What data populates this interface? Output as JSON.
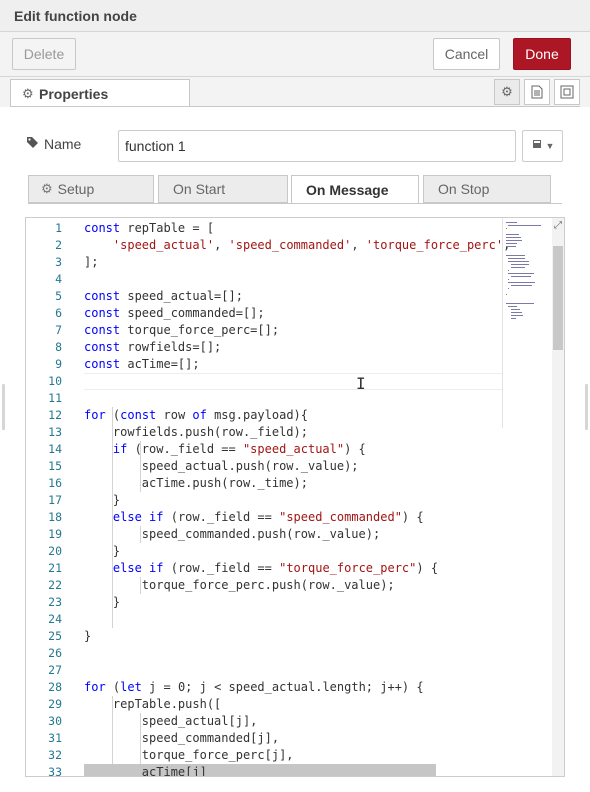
{
  "title": "Edit function node",
  "buttons": {
    "delete": "Delete",
    "cancel": "Cancel",
    "done": "Done"
  },
  "tabs": {
    "properties": "Properties"
  },
  "name_field": {
    "label": "Name",
    "value": "function 1"
  },
  "subtabs": {
    "setup": "Setup",
    "on_start": "On Start",
    "on_message": "On Message",
    "on_stop": "On Stop",
    "active": "On Message"
  },
  "editor": {
    "line_numbers": [
      "1",
      "2",
      "3",
      "4",
      "5",
      "6",
      "7",
      "8",
      "9",
      "10",
      "11",
      "12",
      "13",
      "14",
      "15",
      "16",
      "17",
      "18",
      "19",
      "20",
      "21",
      "22",
      "23",
      "24",
      "25",
      "26",
      "27",
      "28",
      "29",
      "30",
      "31",
      "32",
      "33"
    ],
    "current_line": "10",
    "lines": [
      [
        {
          "t": "const",
          "c": "kw"
        },
        {
          "t": " repTable = ["
        }
      ],
      [
        {
          "t": "    "
        },
        {
          "t": "'speed_actual'",
          "c": "str"
        },
        {
          "t": ", "
        },
        {
          "t": "'speed_commanded'",
          "c": "str"
        },
        {
          "t": ", "
        },
        {
          "t": "'torque_force_perc'",
          "c": "str"
        },
        {
          "t": ","
        }
      ],
      [
        {
          "t": "];"
        }
      ],
      [],
      [
        {
          "t": "const",
          "c": "kw"
        },
        {
          "t": " speed_actual=[];"
        }
      ],
      [
        {
          "t": "const",
          "c": "kw"
        },
        {
          "t": " speed_commanded=[];"
        }
      ],
      [
        {
          "t": "const",
          "c": "kw"
        },
        {
          "t": " torque_force_perc=[];"
        }
      ],
      [
        {
          "t": "const",
          "c": "kw"
        },
        {
          "t": " rowfields=[];"
        }
      ],
      [
        {
          "t": "const",
          "c": "kw"
        },
        {
          "t": " acTime=[];"
        }
      ],
      [],
      [],
      [
        {
          "t": "for",
          "c": "kw"
        },
        {
          "t": " ("
        },
        {
          "t": "const",
          "c": "kw"
        },
        {
          "t": " row "
        },
        {
          "t": "of",
          "c": "kw"
        },
        {
          "t": " msg.payload){"
        }
      ],
      [
        {
          "t": "    rowfields.push(row._field);"
        }
      ],
      [
        {
          "t": "    "
        },
        {
          "t": "if",
          "c": "kw"
        },
        {
          "t": " (row._field == "
        },
        {
          "t": "\"speed_actual\"",
          "c": "str"
        },
        {
          "t": ") {"
        }
      ],
      [
        {
          "t": "        speed_actual.push(row._value);"
        }
      ],
      [
        {
          "t": "        acTime.push(row._time);"
        }
      ],
      [
        {
          "t": "    }"
        }
      ],
      [
        {
          "t": "    "
        },
        {
          "t": "else",
          "c": "kw"
        },
        {
          "t": " "
        },
        {
          "t": "if",
          "c": "kw"
        },
        {
          "t": " (row._field == "
        },
        {
          "t": "\"speed_commanded\"",
          "c": "str"
        },
        {
          "t": ") {"
        }
      ],
      [
        {
          "t": "        speed_commanded.push(row._value);"
        }
      ],
      [
        {
          "t": "    }"
        }
      ],
      [
        {
          "t": "    "
        },
        {
          "t": "else",
          "c": "kw"
        },
        {
          "t": " "
        },
        {
          "t": "if",
          "c": "kw"
        },
        {
          "t": " (row._field == "
        },
        {
          "t": "\"torque_force_perc\"",
          "c": "str"
        },
        {
          "t": ") {"
        }
      ],
      [
        {
          "t": "        torque_force_perc.push(row._value);"
        }
      ],
      [
        {
          "t": "    }"
        }
      ],
      [],
      [
        {
          "t": "}"
        }
      ],
      [],
      [],
      [
        {
          "t": "for",
          "c": "kw"
        },
        {
          "t": " ("
        },
        {
          "t": "let",
          "c": "kw"
        },
        {
          "t": " j = 0; j < speed_actual.length; j++) {"
        }
      ],
      [
        {
          "t": "    repTable.push(["
        }
      ],
      [
        {
          "t": "        speed_actual[j],"
        }
      ],
      [
        {
          "t": "        speed_commanded[j],"
        }
      ],
      [
        {
          "t": "        torque_force_perc[j],"
        }
      ],
      [
        {
          "t": "        acTime[j]"
        }
      ]
    ]
  },
  "icons": [
    "gear-icon",
    "tag-icon",
    "book-icon",
    "caret-down-icon",
    "document-icon",
    "frame-icon",
    "expand-icon",
    "text-cursor-icon"
  ],
  "colors": {
    "done": "#ad1625",
    "keyword": "#0000ff",
    "string": "#a31515",
    "line_number": "#237893"
  }
}
